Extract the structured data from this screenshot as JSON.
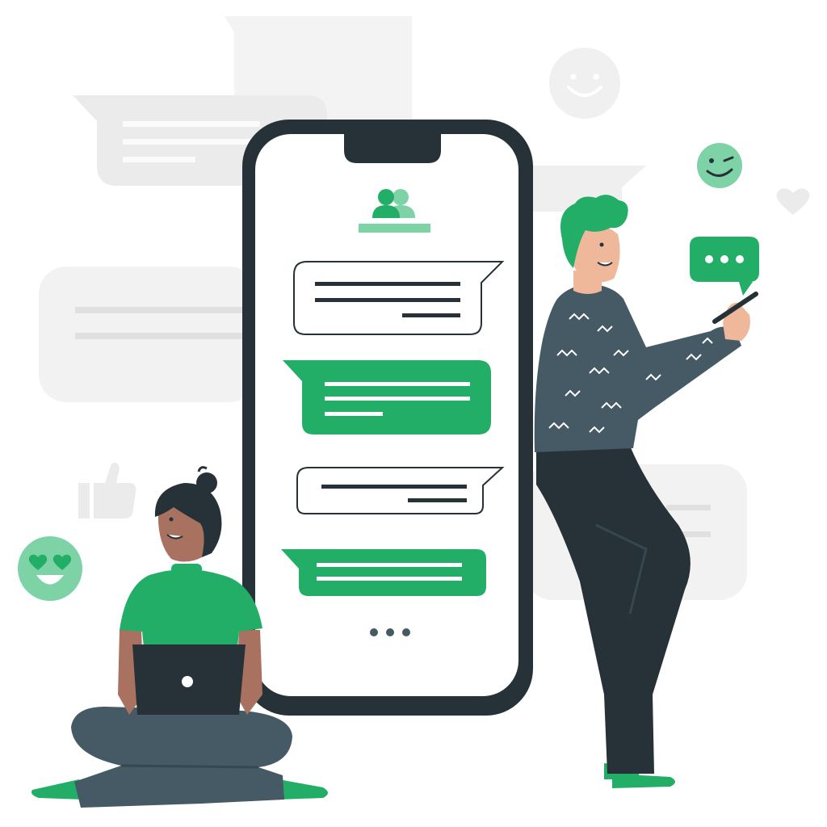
{
  "illustration": {
    "subject": "chat-app-messaging",
    "colors": {
      "accent": "#22AE67",
      "accent_light": "#7ED3A6",
      "dark": "#263238",
      "shirt_dark": "#455A64",
      "bubble_gray": "#EBEBEB",
      "background": "#FFFFFF",
      "skin_light": "#F0B89A",
      "skin_dark": "#A87160"
    },
    "phone": {
      "header_icon": "users-icon",
      "messages": [
        {
          "type": "received",
          "lines": 3
        },
        {
          "type": "sent",
          "lines": 3
        },
        {
          "type": "received",
          "lines": 2
        },
        {
          "type": "sent",
          "lines": 2
        }
      ],
      "typing_indicator": "three-dots"
    },
    "icons": [
      "smiley-face-icon",
      "wink-face-icon",
      "heart-eyes-face-icon",
      "thumbs-up-icon",
      "heart-icon",
      "typing-bubble-icon"
    ],
    "people": [
      "man-standing-with-phone",
      "woman-sitting-with-laptop"
    ]
  }
}
